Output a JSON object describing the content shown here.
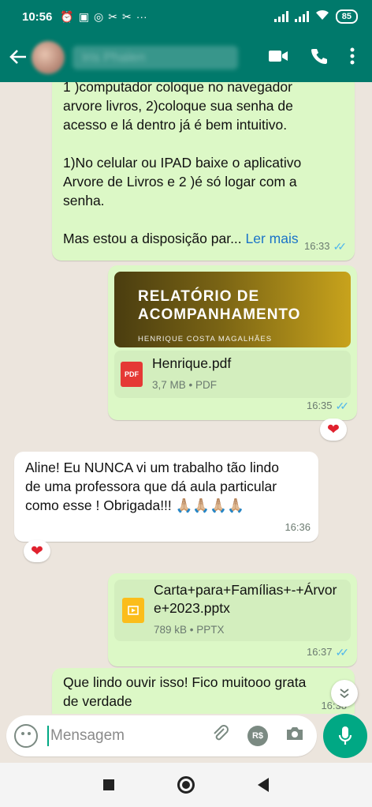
{
  "status_bar": {
    "time": "10:56",
    "battery": "85"
  },
  "header": {
    "contact_name": "Iris Phalen",
    "back_icon": "arrow-left-icon",
    "video_icon": "video-call-icon",
    "call_icon": "phone-icon",
    "menu_icon": "more-vert-icon"
  },
  "messages": [
    {
      "text": "1 )computador coloque no navegador\narvore livros, 2)coloque sua senha de\nacesso e lá dentro já é bem intuitivo.\n\n1)No celular ou IPAD baixe o aplicativo\nArvore de Livros e 2 )é só logar com a\nsenha.\n\nMas estou a disposição par... ",
      "read_more": "Ler mais",
      "time": "16:33"
    },
    {
      "cover_title": "RELATÓRIO DE\nACOMPANHAMENTO",
      "cover_subtitle": "HENRIQUE COSTA MAGALHÃES",
      "file_name": "Henrique.pdf",
      "file_info": "3,7 MB • PDF",
      "file_badge": "PDF",
      "time": "16:35",
      "reaction": "❤"
    },
    {
      "text": "Aline! Eu NUNCA vi um trabalho tão lindo\nde uma professora que dá aula particular\ncomo esse ! Obrigada!!! 🙏🏼🙏🏼🙏🏼🙏🏼",
      "time": "16:36",
      "reaction": "❤"
    },
    {
      "file_name": "Carta+para+Famílias+-+Árvor\ne+2023.pptx",
      "file_info": "789 kB • PPTX",
      "time": "16:37"
    },
    {
      "text": "Que lindo ouvir isso! Fico muitooo grata\nde verdade",
      "time": "16:38"
    }
  ],
  "input": {
    "placeholder": "Mensagem",
    "currency_badge": "R$"
  },
  "colors": {
    "header": "#00796b",
    "outgoing_bubble": "#dcf8c6",
    "incoming_bubble": "#ffffff",
    "accent": "#00a884",
    "read_ticks": "#4fb6ec",
    "link": "#1a73c8"
  }
}
